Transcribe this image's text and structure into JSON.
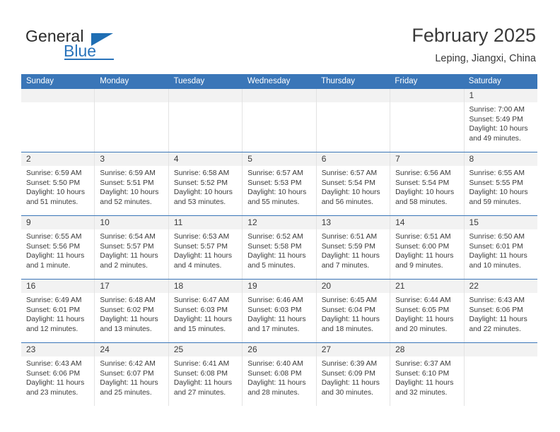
{
  "logo": {
    "word_top": "General",
    "word_bottom": "Blue",
    "triangle_icon": "triangle-icon"
  },
  "header": {
    "title": "February 2025",
    "subtitle": "Leping, Jiangxi, China"
  },
  "calendar": {
    "weekday_headers": [
      "Sunday",
      "Monday",
      "Tuesday",
      "Wednesday",
      "Thursday",
      "Friday",
      "Saturday"
    ],
    "accent_color": "#3a76b8",
    "daynum_band_color": "#f2f2f2",
    "weeks": [
      [
        {
          "empty": true
        },
        {
          "empty": true
        },
        {
          "empty": true
        },
        {
          "empty": true
        },
        {
          "empty": true
        },
        {
          "empty": true
        },
        {
          "day": "1",
          "sunrise": "Sunrise: 7:00 AM",
          "sunset": "Sunset: 5:49 PM",
          "daylight1": "Daylight: 10 hours",
          "daylight2": "and 49 minutes."
        }
      ],
      [
        {
          "day": "2",
          "sunrise": "Sunrise: 6:59 AM",
          "sunset": "Sunset: 5:50 PM",
          "daylight1": "Daylight: 10 hours",
          "daylight2": "and 51 minutes."
        },
        {
          "day": "3",
          "sunrise": "Sunrise: 6:59 AM",
          "sunset": "Sunset: 5:51 PM",
          "daylight1": "Daylight: 10 hours",
          "daylight2": "and 52 minutes."
        },
        {
          "day": "4",
          "sunrise": "Sunrise: 6:58 AM",
          "sunset": "Sunset: 5:52 PM",
          "daylight1": "Daylight: 10 hours",
          "daylight2": "and 53 minutes."
        },
        {
          "day": "5",
          "sunrise": "Sunrise: 6:57 AM",
          "sunset": "Sunset: 5:53 PM",
          "daylight1": "Daylight: 10 hours",
          "daylight2": "and 55 minutes."
        },
        {
          "day": "6",
          "sunrise": "Sunrise: 6:57 AM",
          "sunset": "Sunset: 5:54 PM",
          "daylight1": "Daylight: 10 hours",
          "daylight2": "and 56 minutes."
        },
        {
          "day": "7",
          "sunrise": "Sunrise: 6:56 AM",
          "sunset": "Sunset: 5:54 PM",
          "daylight1": "Daylight: 10 hours",
          "daylight2": "and 58 minutes."
        },
        {
          "day": "8",
          "sunrise": "Sunrise: 6:55 AM",
          "sunset": "Sunset: 5:55 PM",
          "daylight1": "Daylight: 10 hours",
          "daylight2": "and 59 minutes."
        }
      ],
      [
        {
          "day": "9",
          "sunrise": "Sunrise: 6:55 AM",
          "sunset": "Sunset: 5:56 PM",
          "daylight1": "Daylight: 11 hours",
          "daylight2": "and 1 minute."
        },
        {
          "day": "10",
          "sunrise": "Sunrise: 6:54 AM",
          "sunset": "Sunset: 5:57 PM",
          "daylight1": "Daylight: 11 hours",
          "daylight2": "and 2 minutes."
        },
        {
          "day": "11",
          "sunrise": "Sunrise: 6:53 AM",
          "sunset": "Sunset: 5:57 PM",
          "daylight1": "Daylight: 11 hours",
          "daylight2": "and 4 minutes."
        },
        {
          "day": "12",
          "sunrise": "Sunrise: 6:52 AM",
          "sunset": "Sunset: 5:58 PM",
          "daylight1": "Daylight: 11 hours",
          "daylight2": "and 5 minutes."
        },
        {
          "day": "13",
          "sunrise": "Sunrise: 6:51 AM",
          "sunset": "Sunset: 5:59 PM",
          "daylight1": "Daylight: 11 hours",
          "daylight2": "and 7 minutes."
        },
        {
          "day": "14",
          "sunrise": "Sunrise: 6:51 AM",
          "sunset": "Sunset: 6:00 PM",
          "daylight1": "Daylight: 11 hours",
          "daylight2": "and 9 minutes."
        },
        {
          "day": "15",
          "sunrise": "Sunrise: 6:50 AM",
          "sunset": "Sunset: 6:01 PM",
          "daylight1": "Daylight: 11 hours",
          "daylight2": "and 10 minutes."
        }
      ],
      [
        {
          "day": "16",
          "sunrise": "Sunrise: 6:49 AM",
          "sunset": "Sunset: 6:01 PM",
          "daylight1": "Daylight: 11 hours",
          "daylight2": "and 12 minutes."
        },
        {
          "day": "17",
          "sunrise": "Sunrise: 6:48 AM",
          "sunset": "Sunset: 6:02 PM",
          "daylight1": "Daylight: 11 hours",
          "daylight2": "and 13 minutes."
        },
        {
          "day": "18",
          "sunrise": "Sunrise: 6:47 AM",
          "sunset": "Sunset: 6:03 PM",
          "daylight1": "Daylight: 11 hours",
          "daylight2": "and 15 minutes."
        },
        {
          "day": "19",
          "sunrise": "Sunrise: 6:46 AM",
          "sunset": "Sunset: 6:03 PM",
          "daylight1": "Daylight: 11 hours",
          "daylight2": "and 17 minutes."
        },
        {
          "day": "20",
          "sunrise": "Sunrise: 6:45 AM",
          "sunset": "Sunset: 6:04 PM",
          "daylight1": "Daylight: 11 hours",
          "daylight2": "and 18 minutes."
        },
        {
          "day": "21",
          "sunrise": "Sunrise: 6:44 AM",
          "sunset": "Sunset: 6:05 PM",
          "daylight1": "Daylight: 11 hours",
          "daylight2": "and 20 minutes."
        },
        {
          "day": "22",
          "sunrise": "Sunrise: 6:43 AM",
          "sunset": "Sunset: 6:06 PM",
          "daylight1": "Daylight: 11 hours",
          "daylight2": "and 22 minutes."
        }
      ],
      [
        {
          "day": "23",
          "sunrise": "Sunrise: 6:43 AM",
          "sunset": "Sunset: 6:06 PM",
          "daylight1": "Daylight: 11 hours",
          "daylight2": "and 23 minutes."
        },
        {
          "day": "24",
          "sunrise": "Sunrise: 6:42 AM",
          "sunset": "Sunset: 6:07 PM",
          "daylight1": "Daylight: 11 hours",
          "daylight2": "and 25 minutes."
        },
        {
          "day": "25",
          "sunrise": "Sunrise: 6:41 AM",
          "sunset": "Sunset: 6:08 PM",
          "daylight1": "Daylight: 11 hours",
          "daylight2": "and 27 minutes."
        },
        {
          "day": "26",
          "sunrise": "Sunrise: 6:40 AM",
          "sunset": "Sunset: 6:08 PM",
          "daylight1": "Daylight: 11 hours",
          "daylight2": "and 28 minutes."
        },
        {
          "day": "27",
          "sunrise": "Sunrise: 6:39 AM",
          "sunset": "Sunset: 6:09 PM",
          "daylight1": "Daylight: 11 hours",
          "daylight2": "and 30 minutes."
        },
        {
          "day": "28",
          "sunrise": "Sunrise: 6:37 AM",
          "sunset": "Sunset: 6:10 PM",
          "daylight1": "Daylight: 11 hours",
          "daylight2": "and 32 minutes."
        },
        {
          "empty": true
        }
      ]
    ]
  }
}
